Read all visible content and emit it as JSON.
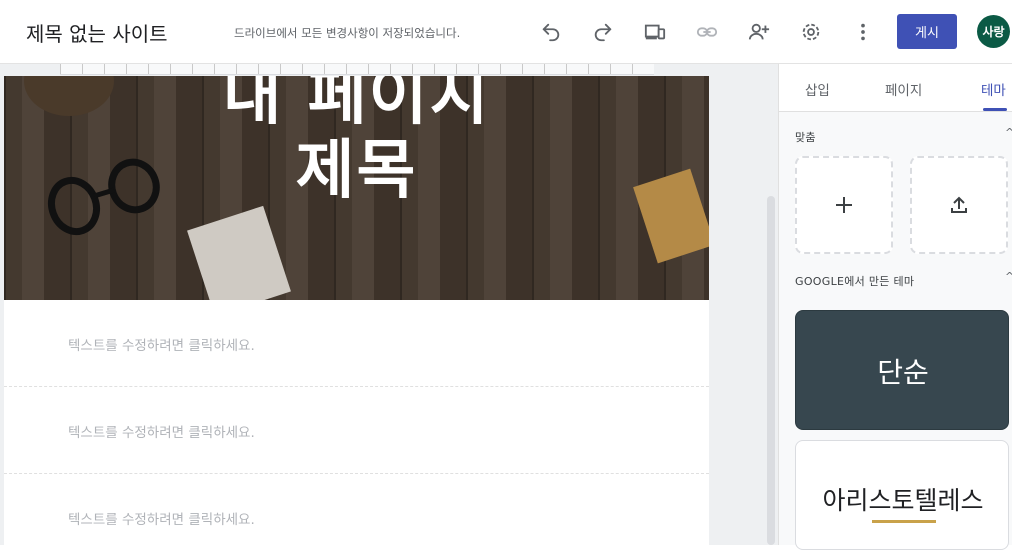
{
  "header": {
    "site_title": "제목 없는 사이트",
    "save_status": "드라이브에서 모든 변경사항이 저장되었습니다.",
    "publish_label": "게시",
    "avatar_initials": "사랑",
    "icons": [
      "undo-icon",
      "redo-icon",
      "preview-devices-icon",
      "link-icon",
      "add-person-icon",
      "settings-gear-icon",
      "more-vert-icon"
    ]
  },
  "page": {
    "title": "내 페이지\n제목",
    "text_blocks": [
      "텍스트를 수정하려면 클릭하세요.",
      "텍스트를 수정하려면 클릭하세요.",
      "텍스트를 수정하려면 클릭하세요."
    ]
  },
  "panel": {
    "tabs": [
      "삽입",
      "페이지",
      "테마"
    ],
    "active_tab": "테마",
    "custom_section_label": "맞춤",
    "google_section_label": "GOOGLE에서 만든 테마",
    "themes": [
      "단순",
      "아리스토텔레스"
    ]
  },
  "colors": {
    "accent": "#3f51b5",
    "avatar_bg": "#0b5a45",
    "theme_simple_bg": "#37474f",
    "theme_aristotle_accent": "#c9a24a"
  }
}
